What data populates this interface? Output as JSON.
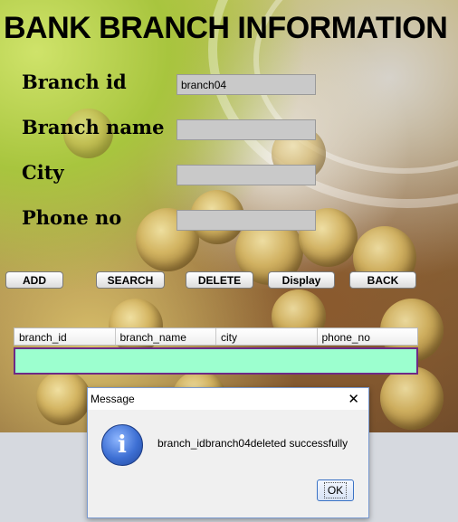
{
  "header": {
    "title": "BANK BRANCH INFORMATION"
  },
  "form": {
    "branch_id_label": "Branch id",
    "branch_id_value": "branch04",
    "branch_name_label": "Branch name",
    "branch_name_value": "",
    "city_label": "City",
    "city_value": "",
    "phone_label": "Phone no",
    "phone_value": ""
  },
  "buttons": {
    "add": "ADD",
    "search": "SEARCH",
    "delete": "DELETE",
    "display": "Display",
    "back": "BACK"
  },
  "table": {
    "columns": [
      "branch_id",
      "branch_name",
      "city",
      "phone_no"
    ]
  },
  "dialog": {
    "title": "Message",
    "close_glyph": "✕",
    "icon_glyph": "i",
    "message": "branch_idbranch04deleted successfully",
    "ok": "OK"
  }
}
